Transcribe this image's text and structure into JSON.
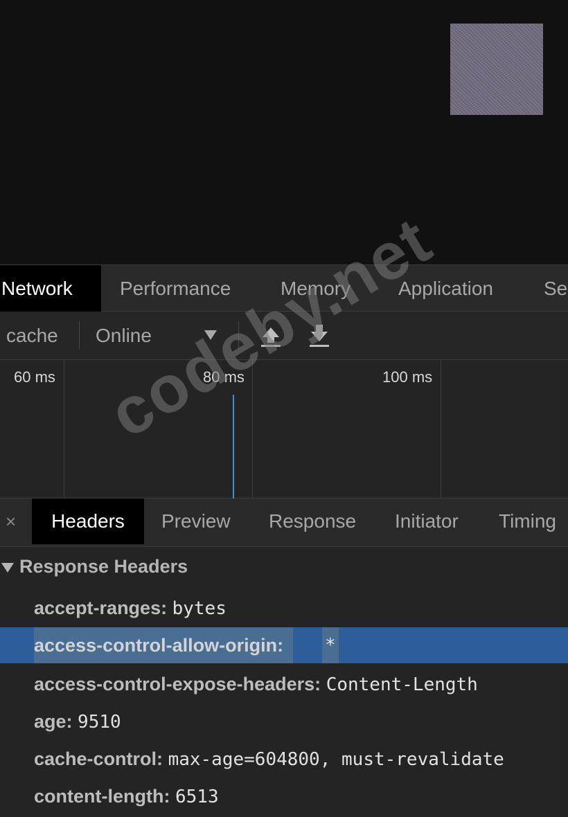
{
  "main_tabs": [
    {
      "label": "Network",
      "active": true
    },
    {
      "label": "Performance",
      "active": false
    },
    {
      "label": "Memory",
      "active": false
    },
    {
      "label": "Application",
      "active": false
    },
    {
      "label": "Se",
      "active": false
    }
  ],
  "toolbar": {
    "cache_label": "cache",
    "throttle_value": "Online",
    "dropdown_icon": "triangle-down-icon",
    "upload_icon": "import-har-icon",
    "download_icon": "export-har-icon"
  },
  "timeline": {
    "ticks": [
      "60 ms",
      "80 ms",
      "100 ms"
    ],
    "marker_color": "#3a8ee6"
  },
  "detail_tabs": {
    "close": "×",
    "tabs": [
      {
        "label": "Headers",
        "active": true
      },
      {
        "label": "Preview",
        "active": false
      },
      {
        "label": "Response",
        "active": false
      },
      {
        "label": "Initiator",
        "active": false
      },
      {
        "label": "Timing",
        "active": false
      }
    ]
  },
  "response_headers": {
    "title": "Response Headers",
    "rows": [
      {
        "name": "accept-ranges:",
        "value": "bytes",
        "selected": false
      },
      {
        "name": "access-control-allow-origin:",
        "value": "*",
        "selected": true
      },
      {
        "name": "access-control-expose-headers:",
        "value": "Content-Length",
        "selected": false
      },
      {
        "name": "age:",
        "value": "9510",
        "selected": false
      },
      {
        "name": "cache-control:",
        "value": "max-age=604800, must-revalidate",
        "selected": false
      },
      {
        "name": "content-length:",
        "value": "6513",
        "selected": false
      }
    ]
  },
  "watermark": "codeby.net",
  "colors": {
    "selection": "#2d5e99",
    "active_tab_bg": "#000000",
    "panel_bg": "#242424"
  }
}
